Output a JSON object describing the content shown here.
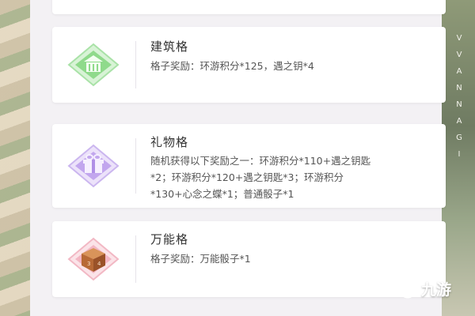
{
  "cells": [
    {
      "title": "建筑格",
      "description": "格子奖励：环游积分*125，遇之钥*4",
      "icon": "building-icon",
      "icon_color": "#7fd686"
    },
    {
      "title": "礼物格",
      "description": "随机获得以下奖励之一：环游积分*110+遇之钥匙*2；环游积分*120+遇之钥匙*3；环游积分*130+心念之蝶*1；普通骰子*1",
      "icon": "gift-icon",
      "icon_color": "#b99ae6"
    },
    {
      "title": "万能格",
      "description": "格子奖励：万能骰子*1",
      "icon": "dice-icon",
      "icon_color": "#f0a3b2"
    }
  ],
  "side_text": [
    "V",
    "V",
    "A",
    "N",
    "N",
    "A",
    "G",
    "I"
  ],
  "watermark": "九游"
}
